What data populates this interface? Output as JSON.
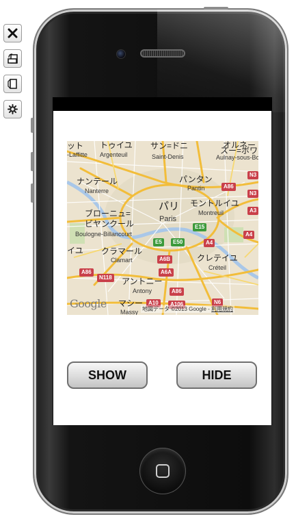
{
  "toolbar": {
    "items": [
      {
        "icon": "close-icon"
      },
      {
        "icon": "rotate-left-icon"
      },
      {
        "icon": "rotate-right-icon"
      },
      {
        "icon": "settings-gear-icon"
      }
    ]
  },
  "map": {
    "labels": [
      {
        "text": "ット",
        "lang": "jp"
      },
      {
        "text": "トゥイユ",
        "lang": "jp"
      },
      {
        "text": "サン=ドニ",
        "lang": "jp"
      },
      {
        "text": "オルネー",
        "lang": "jp"
      },
      {
        "text": "スー=ボワ",
        "lang": "jp"
      },
      {
        "text": "-Laffitte",
        "lang": "en"
      },
      {
        "text": "Argenteuil",
        "lang": "en"
      },
      {
        "text": "Saint-Denis",
        "lang": "en"
      },
      {
        "text": "Aulnay-sous-Bois",
        "lang": "en"
      },
      {
        "text": "ナンテール",
        "lang": "jp"
      },
      {
        "text": "Nanterre",
        "lang": "en"
      },
      {
        "text": "パンタン",
        "lang": "jp"
      },
      {
        "text": "Pantin",
        "lang": "en"
      },
      {
        "text": "パリ",
        "lang": "jp"
      },
      {
        "text": "Paris",
        "lang": "en"
      },
      {
        "text": "モントルイユ",
        "lang": "jp"
      },
      {
        "text": "Montreuil",
        "lang": "en"
      },
      {
        "text": "ブローニュ=",
        "lang": "jp"
      },
      {
        "text": "ビヤンクール",
        "lang": "jp"
      },
      {
        "text": "Boulogne-Billancourt",
        "lang": "en"
      },
      {
        "text": "イユ",
        "lang": "jp"
      },
      {
        "text": "クラマール",
        "lang": "jp"
      },
      {
        "text": "Clamart",
        "lang": "en"
      },
      {
        "text": "クレテイユ",
        "lang": "jp"
      },
      {
        "text": "Créteil",
        "lang": "en"
      },
      {
        "text": "アントニー",
        "lang": "jp"
      },
      {
        "text": "Antony",
        "lang": "en"
      },
      {
        "text": "マシー",
        "lang": "jp"
      },
      {
        "text": "Massy",
        "lang": "en"
      }
    ],
    "shields": [
      {
        "text": "A86",
        "color": "red"
      },
      {
        "text": "N3",
        "color": "red"
      },
      {
        "text": "N3",
        "color": "red"
      },
      {
        "text": "A3",
        "color": "red"
      },
      {
        "text": "E15",
        "color": "green"
      },
      {
        "text": "E5",
        "color": "green"
      },
      {
        "text": "E50",
        "color": "green"
      },
      {
        "text": "A4",
        "color": "red"
      },
      {
        "text": "A4",
        "color": "red"
      },
      {
        "text": "A6B",
        "color": "red"
      },
      {
        "text": "A6A",
        "color": "red"
      },
      {
        "text": "A86",
        "color": "red"
      },
      {
        "text": "N118",
        "color": "red"
      },
      {
        "text": "A86",
        "color": "red"
      },
      {
        "text": "A10",
        "color": "red"
      },
      {
        "text": "A106",
        "color": "red"
      },
      {
        "text": "N6",
        "color": "red"
      }
    ],
    "logo_text": "Google",
    "attribution_text": "地図データ ©2013 Google - ",
    "terms_link": "利用規約"
  },
  "buttons": {
    "show_label": "SHOW",
    "hide_label": "HIDE"
  },
  "colors": {
    "map_land": "#ece3cf",
    "map_major_road": "#f7c94a",
    "map_minor_road": "#ffffff",
    "shield_red": "#c9404a",
    "shield_green": "#3c9a3c"
  }
}
